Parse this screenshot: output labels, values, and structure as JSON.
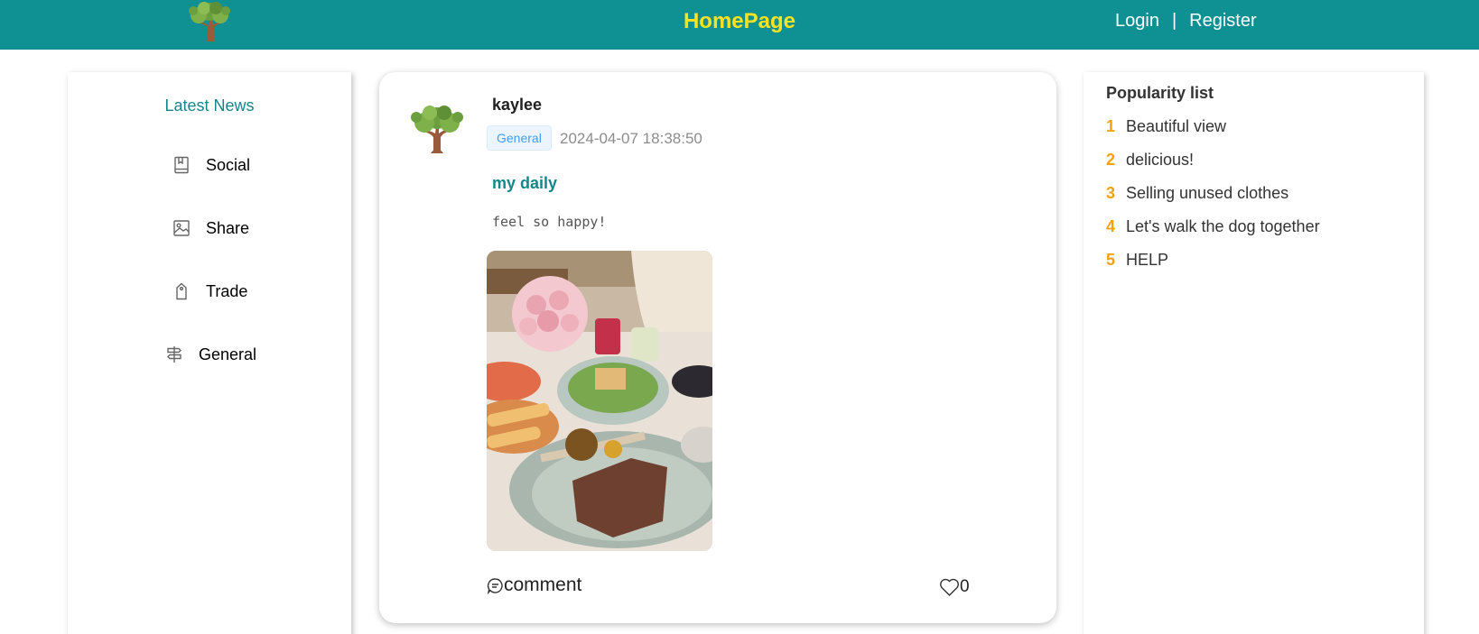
{
  "header": {
    "title": "HomePage",
    "login_label": "Login",
    "separator": "|",
    "register_label": "Register",
    "logo_icon": "tree-icon"
  },
  "sidebar": {
    "title": "Latest News",
    "items": [
      {
        "label": "Social",
        "icon": "book-icon"
      },
      {
        "label": "Share",
        "icon": "image-icon"
      },
      {
        "label": "Trade",
        "icon": "price-tag-icon"
      },
      {
        "label": "General",
        "icon": "signpost-icon"
      }
    ]
  },
  "post": {
    "username": "kaylee",
    "tag": "General",
    "date": "2024-04-07 18:38:50",
    "title": "my daily",
    "body": "feel so happy!",
    "comment_label": "comment",
    "like_count": "0"
  },
  "popularity": {
    "title": "Popularity list",
    "items": [
      {
        "rank": "1",
        "label": "Beautiful view"
      },
      {
        "rank": "2",
        "label": "delicious!"
      },
      {
        "rank": "3",
        "label": "Selling unused clothes"
      },
      {
        "rank": "4",
        "label": "Let's walk the dog together"
      },
      {
        "rank": "5",
        "label": "HELP"
      }
    ]
  },
  "colors": {
    "header_bg": "#0f9193",
    "title_yellow": "#ffe21f",
    "accent_teal": "#15868a",
    "rank_orange": "#f5a20b"
  }
}
